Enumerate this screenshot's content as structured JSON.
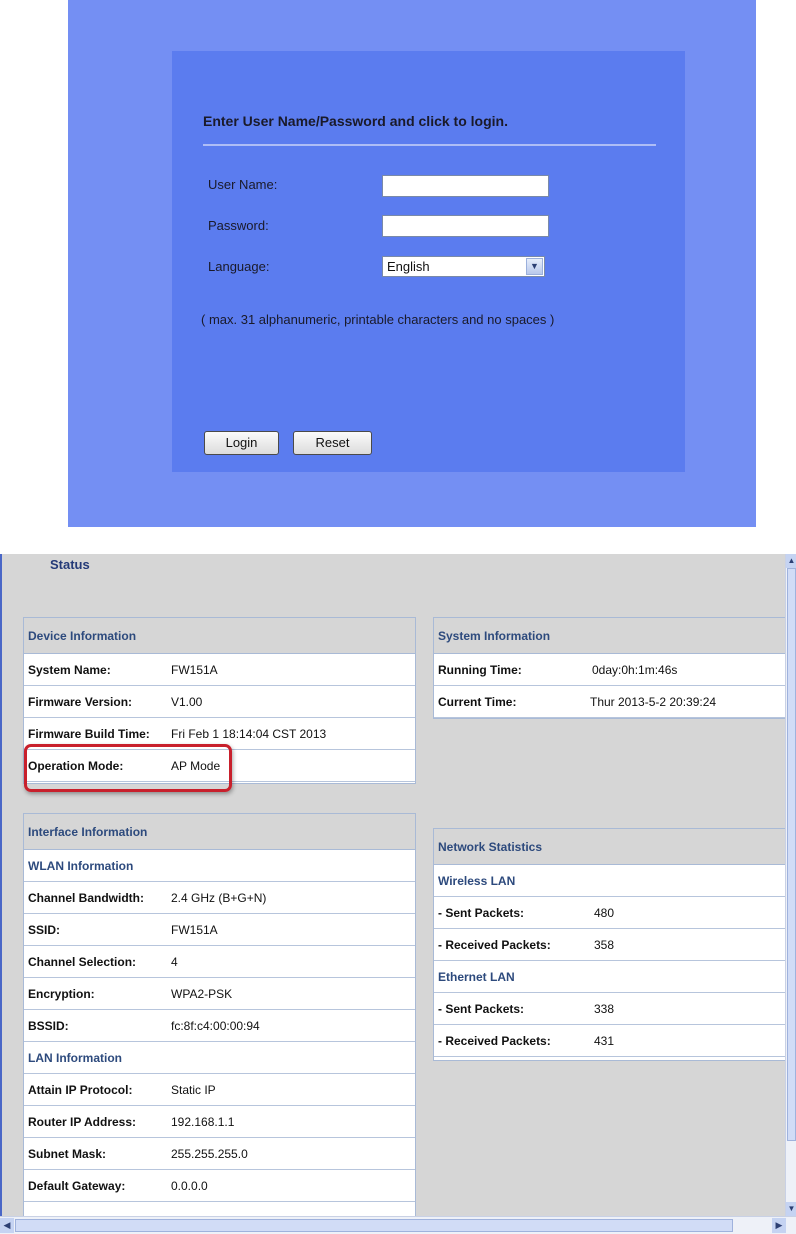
{
  "login": {
    "heading": "Enter User Name/Password and click to login.",
    "username_label": "User Name:",
    "username_value": "",
    "password_label": "Password:",
    "password_value": "",
    "language_label": "Language:",
    "language_selected": "English",
    "hint": "( max. 31 alphanumeric, printable characters and no spaces )",
    "login_button": "Login",
    "reset_button": "Reset"
  },
  "status": {
    "title": "Status",
    "device_info": {
      "header": "Device Information",
      "rows": [
        {
          "label": "System Name:",
          "value": "FW151A"
        },
        {
          "label": "Firmware Version:",
          "value": "V1.00"
        },
        {
          "label": "Firmware Build Time:",
          "value": "Fri Feb 1 18:14:04 CST 2013"
        },
        {
          "label": "Operation Mode:",
          "value": "AP Mode"
        }
      ]
    },
    "system_info": {
      "header": "System Information",
      "rows": [
        {
          "label": "Running Time:",
          "value": "0day:0h:1m:46s"
        },
        {
          "label": "Current Time:",
          "value": "Thur 2013-5-2 20:39:24"
        }
      ]
    },
    "interface_info": {
      "header": "Interface Information",
      "wlan_header": "WLAN Information",
      "wlan_rows": [
        {
          "label": "Channel Bandwidth:",
          "value": "2.4 GHz (B+G+N)"
        },
        {
          "label": "SSID:",
          "value": "FW151A"
        },
        {
          "label": "Channel Selection:",
          "value": "4"
        },
        {
          "label": "Encryption:",
          "value": "WPA2-PSK"
        },
        {
          "label": "BSSID:",
          "value": "fc:8f:c4:00:00:94"
        }
      ],
      "lan_header": "LAN Information",
      "lan_rows": [
        {
          "label": "Attain IP Protocol:",
          "value": "Static IP"
        },
        {
          "label": "Router IP Address:",
          "value": "192.168.1.1"
        },
        {
          "label": "Subnet Mask:",
          "value": "255.255.255.0"
        },
        {
          "label": "Default Gateway:",
          "value": "0.0.0.0"
        }
      ]
    },
    "network_stats": {
      "header": "Network Statistics",
      "wireless_header": "Wireless LAN",
      "wireless_rows": [
        {
          "label": "- Sent Packets:",
          "value": "480"
        },
        {
          "label": "- Received Packets:",
          "value": "358"
        }
      ],
      "ethernet_header": "Ethernet LAN",
      "ethernet_rows": [
        {
          "label": "- Sent Packets:",
          "value": "338"
        },
        {
          "label": "- Received Packets:",
          "value": "431"
        }
      ]
    },
    "highlight_color": "#c8202c"
  }
}
